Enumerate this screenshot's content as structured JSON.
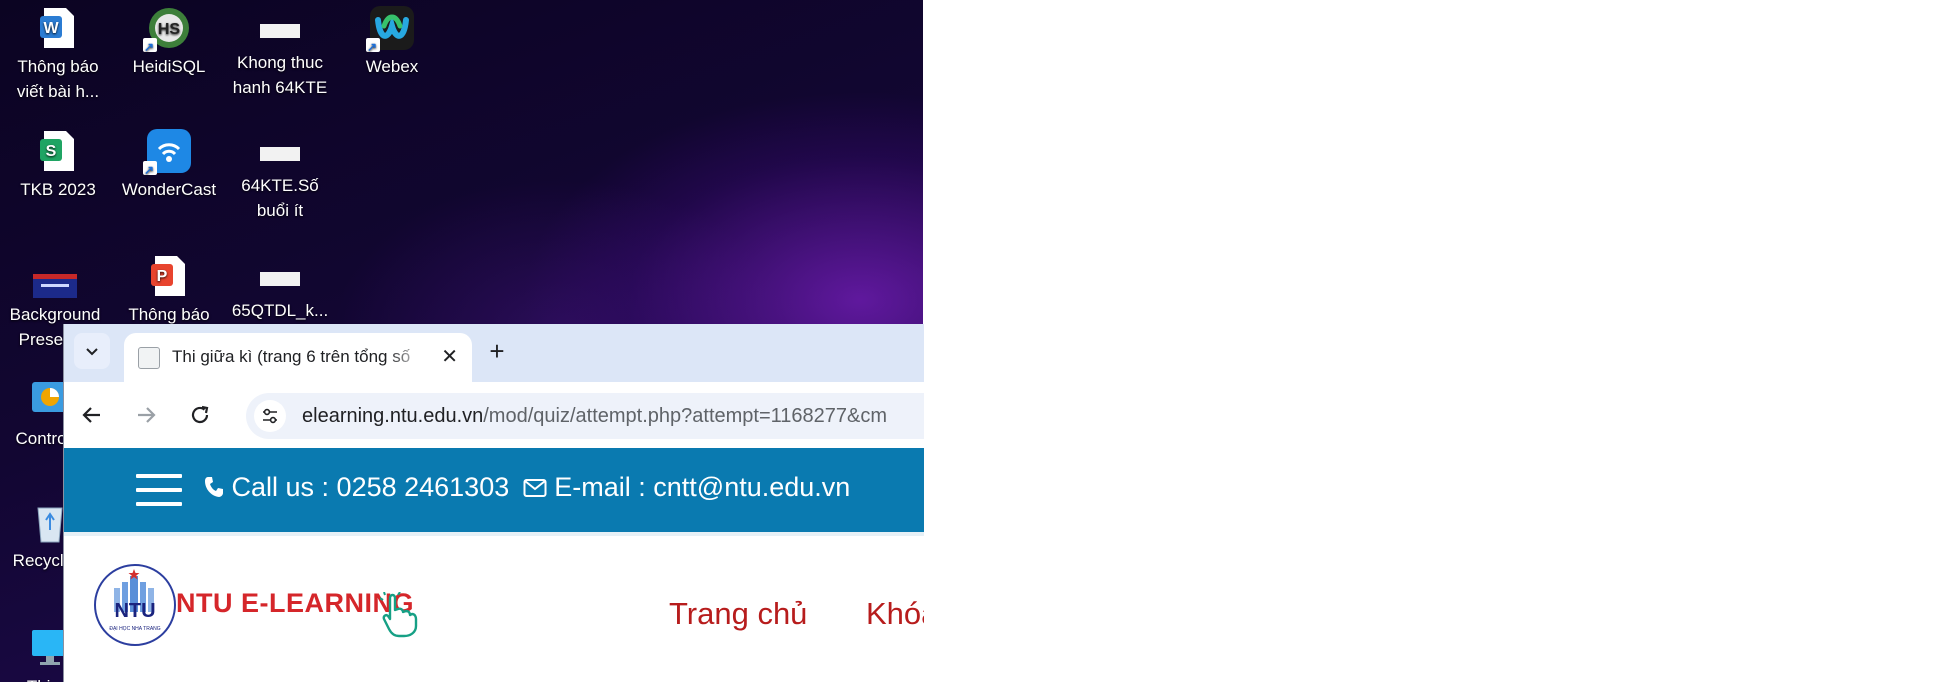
{
  "desktop": {
    "icons": [
      {
        "name": "word-icon",
        "label": "Thông báo\nviết bài h..."
      },
      {
        "name": "heidisql-icon",
        "label": "HeidiSQL"
      },
      {
        "name": "file-icon",
        "label": "Khong thuc\nhanh 64KTE"
      },
      {
        "name": "webex-icon",
        "label": "Webex"
      },
      {
        "name": "spreadsheet-icon",
        "label": "TKB 2023"
      },
      {
        "name": "wondercast-icon",
        "label": "WonderCast"
      },
      {
        "name": "file-icon",
        "label": "64KTE.Số\nbuổi ít"
      },
      {
        "name": "image-icon",
        "label": "Background\nPresent..."
      },
      {
        "name": "presentation-icon",
        "label": "Thông báo"
      },
      {
        "name": "file-icon",
        "label": "65QTDL_k..."
      },
      {
        "name": "control-panel-icon",
        "label": "Control..."
      },
      {
        "name": "recycle-bin-icon",
        "label": "Recycle..."
      },
      {
        "name": "this-pc-icon",
        "label": "This..."
      }
    ]
  },
  "browser": {
    "tab_title": "Thi giữa kì (trang 6 trên tổng số",
    "new_tab_symbol": "+",
    "close_symbol": "✕",
    "url_host": "elearning.ntu.edu.vn",
    "url_path": "/mod/quiz/attempt.php?attempt=1168277&cm"
  },
  "site": {
    "call_label": "Call us : 0258 2461303",
    "email_label": "E-mail : cntt@ntu.edu.vn",
    "logo_badge": "NTU",
    "logo_caption": "ĐẠI HỌC NHA TRANG",
    "brand": "NTU E-LEARNING",
    "menu": [
      "Trang chủ",
      "Khóa"
    ]
  },
  "colors": {
    "topbar": "#0a7ab0",
    "brand_red": "#d5262a",
    "menu_red": "#b71c1c",
    "tab_strip": "#dce6f7"
  }
}
